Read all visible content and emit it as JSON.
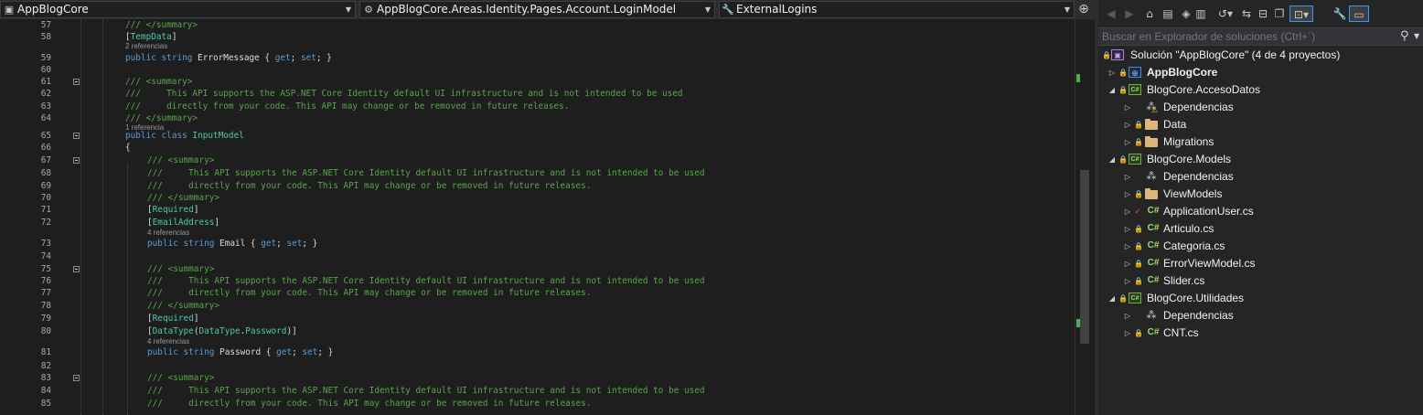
{
  "editor": {
    "nav": {
      "project": "AppBlogCore",
      "type": "AppBlogCore.Areas.Identity.Pages.Account.LoginModel",
      "member": "ExternalLogins"
    },
    "lines": [
      {
        "n": "57",
        "ind": 2,
        "tokens": [
          {
            "t": "/// </summary>",
            "c": "c"
          }
        ]
      },
      {
        "n": "58",
        "ind": 2,
        "tokens": [
          {
            "t": "[",
            "c": "p"
          },
          {
            "t": "TempData",
            "c": "t"
          },
          {
            "t": "]",
            "c": "p"
          }
        ]
      },
      {
        "lens": "2 referencias",
        "ind": 2
      },
      {
        "n": "59",
        "ind": 2,
        "tokens": [
          {
            "t": "public",
            "c": "k"
          },
          {
            "t": " ",
            "c": "p"
          },
          {
            "t": "string",
            "c": "k"
          },
          {
            "t": " ErrorMessage { ",
            "c": "p"
          },
          {
            "t": "get",
            "c": "k"
          },
          {
            "t": "; ",
            "c": "p"
          },
          {
            "t": "set",
            "c": "k"
          },
          {
            "t": "; }",
            "c": "p"
          }
        ]
      },
      {
        "n": "60",
        "ind": 2,
        "tokens": []
      },
      {
        "n": "61",
        "ind": 2,
        "fold": true,
        "tokens": [
          {
            "t": "/// <summary>",
            "c": "c"
          }
        ]
      },
      {
        "n": "62",
        "ind": 2,
        "tokens": [
          {
            "t": "///     This API supports the ASP.NET Core Identity default UI infrastructure and is not intended to be used",
            "c": "c"
          }
        ]
      },
      {
        "n": "63",
        "ind": 2,
        "tokens": [
          {
            "t": "///     directly from your code. This API may change or be removed in future releases.",
            "c": "c"
          }
        ]
      },
      {
        "n": "64",
        "ind": 2,
        "tokens": [
          {
            "t": "/// </summary>",
            "c": "c"
          }
        ]
      },
      {
        "lens": "1 referencia",
        "ind": 2
      },
      {
        "n": "65",
        "ind": 2,
        "fold": true,
        "tokens": [
          {
            "t": "public",
            "c": "k"
          },
          {
            "t": " ",
            "c": "p"
          },
          {
            "t": "class",
            "c": "k"
          },
          {
            "t": " ",
            "c": "p"
          },
          {
            "t": "InputModel",
            "c": "t"
          }
        ]
      },
      {
        "n": "66",
        "ind": 2,
        "tokens": [
          {
            "t": "{",
            "c": "p"
          }
        ]
      },
      {
        "n": "67",
        "ind": 3,
        "fold": true,
        "tokens": [
          {
            "t": "/// <summary>",
            "c": "c"
          }
        ]
      },
      {
        "n": "68",
        "ind": 3,
        "tokens": [
          {
            "t": "///     This API supports the ASP.NET Core Identity default UI infrastructure and is not intended to be used",
            "c": "c"
          }
        ]
      },
      {
        "n": "69",
        "ind": 3,
        "tokens": [
          {
            "t": "///     directly from your code. This API may change or be removed in future releases.",
            "c": "c"
          }
        ]
      },
      {
        "n": "70",
        "ind": 3,
        "tokens": [
          {
            "t": "/// </summary>",
            "c": "c"
          }
        ]
      },
      {
        "n": "71",
        "ind": 3,
        "tokens": [
          {
            "t": "[",
            "c": "p"
          },
          {
            "t": "Required",
            "c": "t"
          },
          {
            "t": "]",
            "c": "p"
          }
        ]
      },
      {
        "n": "72",
        "ind": 3,
        "tokens": [
          {
            "t": "[",
            "c": "p"
          },
          {
            "t": "EmailAddress",
            "c": "t"
          },
          {
            "t": "]",
            "c": "p"
          }
        ]
      },
      {
        "lens": "4 referencias",
        "ind": 3
      },
      {
        "n": "73",
        "ind": 3,
        "tokens": [
          {
            "t": "public",
            "c": "k"
          },
          {
            "t": " ",
            "c": "p"
          },
          {
            "t": "string",
            "c": "k"
          },
          {
            "t": " Email { ",
            "c": "p"
          },
          {
            "t": "get",
            "c": "k"
          },
          {
            "t": "; ",
            "c": "p"
          },
          {
            "t": "set",
            "c": "k"
          },
          {
            "t": "; }",
            "c": "p"
          }
        ]
      },
      {
        "n": "74",
        "ind": 3,
        "tokens": []
      },
      {
        "n": "75",
        "ind": 3,
        "fold": true,
        "tokens": [
          {
            "t": "/// <summary>",
            "c": "c"
          }
        ]
      },
      {
        "n": "76",
        "ind": 3,
        "tokens": [
          {
            "t": "///     This API supports the ASP.NET Core Identity default UI infrastructure and is not intended to be used",
            "c": "c"
          }
        ]
      },
      {
        "n": "77",
        "ind": 3,
        "tokens": [
          {
            "t": "///     directly from your code. This API may change or be removed in future releases.",
            "c": "c"
          }
        ]
      },
      {
        "n": "78",
        "ind": 3,
        "tokens": [
          {
            "t": "/// </summary>",
            "c": "c"
          }
        ]
      },
      {
        "n": "79",
        "ind": 3,
        "tokens": [
          {
            "t": "[",
            "c": "p"
          },
          {
            "t": "Required",
            "c": "t"
          },
          {
            "t": "]",
            "c": "p"
          }
        ]
      },
      {
        "n": "80",
        "ind": 3,
        "tokens": [
          {
            "t": "[",
            "c": "p"
          },
          {
            "t": "DataType",
            "c": "t"
          },
          {
            "t": "(",
            "c": "p"
          },
          {
            "t": "DataType",
            "c": "t"
          },
          {
            "t": ".",
            "c": "p"
          },
          {
            "t": "Password",
            "c": "t"
          },
          {
            "t": ")]",
            "c": "p"
          }
        ]
      },
      {
        "lens": "4 referencias",
        "ind": 3
      },
      {
        "n": "81",
        "ind": 3,
        "tokens": [
          {
            "t": "public",
            "c": "k"
          },
          {
            "t": " ",
            "c": "p"
          },
          {
            "t": "string",
            "c": "k"
          },
          {
            "t": " Password { ",
            "c": "p"
          },
          {
            "t": "get",
            "c": "k"
          },
          {
            "t": "; ",
            "c": "p"
          },
          {
            "t": "set",
            "c": "k"
          },
          {
            "t": "; }",
            "c": "p"
          }
        ]
      },
      {
        "n": "82",
        "ind": 3,
        "tokens": []
      },
      {
        "n": "83",
        "ind": 3,
        "fold": true,
        "tokens": [
          {
            "t": "/// <summary>",
            "c": "c"
          }
        ]
      },
      {
        "n": "84",
        "ind": 3,
        "tokens": [
          {
            "t": "///     This API supports the ASP.NET Core Identity default UI infrastructure and is not intended to be used",
            "c": "c"
          }
        ]
      },
      {
        "n": "85",
        "ind": 3,
        "tokens": [
          {
            "t": "///     directly from your code. This API may change or be removed in future releases.",
            "c": "c"
          }
        ]
      }
    ]
  },
  "solution_explorer": {
    "search_placeholder": "Buscar en Explorador de soluciones (Ctrl+´)",
    "items": [
      {
        "label": "Solución \"AppBlogCore\"  (4 de 4 proyectos)",
        "level": 0,
        "icon": "sln",
        "expander": "none"
      },
      {
        "label": "AppBlogCore",
        "level": 1,
        "icon": "web",
        "expander": "collapsed",
        "bold": true
      },
      {
        "label": "BlogCore.AccesoDatos",
        "level": 1,
        "icon": "proj",
        "expander": "expanded"
      },
      {
        "label": "Dependencias",
        "level": 2,
        "icon": "dep-warn",
        "expander": "collapsed"
      },
      {
        "label": "Data",
        "level": 2,
        "icon": "folder",
        "expander": "collapsed"
      },
      {
        "label": "Migrations",
        "level": 2,
        "icon": "folder",
        "expander": "collapsed"
      },
      {
        "label": "BlogCore.Models",
        "level": 1,
        "icon": "proj",
        "expander": "expanded"
      },
      {
        "label": "Dependencias",
        "level": 2,
        "icon": "dep",
        "expander": "collapsed"
      },
      {
        "label": "ViewModels",
        "level": 2,
        "icon": "folder",
        "expander": "collapsed"
      },
      {
        "label": "ApplicationUser.cs",
        "level": 2,
        "icon": "cs",
        "expander": "collapsed",
        "check": true
      },
      {
        "label": "Articulo.cs",
        "level": 2,
        "icon": "cs",
        "expander": "collapsed"
      },
      {
        "label": "Categoria.cs",
        "level": 2,
        "icon": "cs",
        "expander": "collapsed"
      },
      {
        "label": "ErrorViewModel.cs",
        "level": 2,
        "icon": "cs",
        "expander": "collapsed"
      },
      {
        "label": "Slider.cs",
        "level": 2,
        "icon": "cs",
        "expander": "collapsed"
      },
      {
        "label": "BlogCore.Utilidades",
        "level": 1,
        "icon": "proj",
        "expander": "expanded"
      },
      {
        "label": "Dependencias",
        "level": 2,
        "icon": "dep",
        "expander": "collapsed"
      },
      {
        "label": "CNT.cs",
        "level": 2,
        "icon": "cs",
        "expander": "collapsed"
      }
    ]
  },
  "colors": {
    "comment": "#57a64a",
    "keyword": "#569cd6",
    "type": "#4ec9b0",
    "accent": "#3399ff"
  }
}
